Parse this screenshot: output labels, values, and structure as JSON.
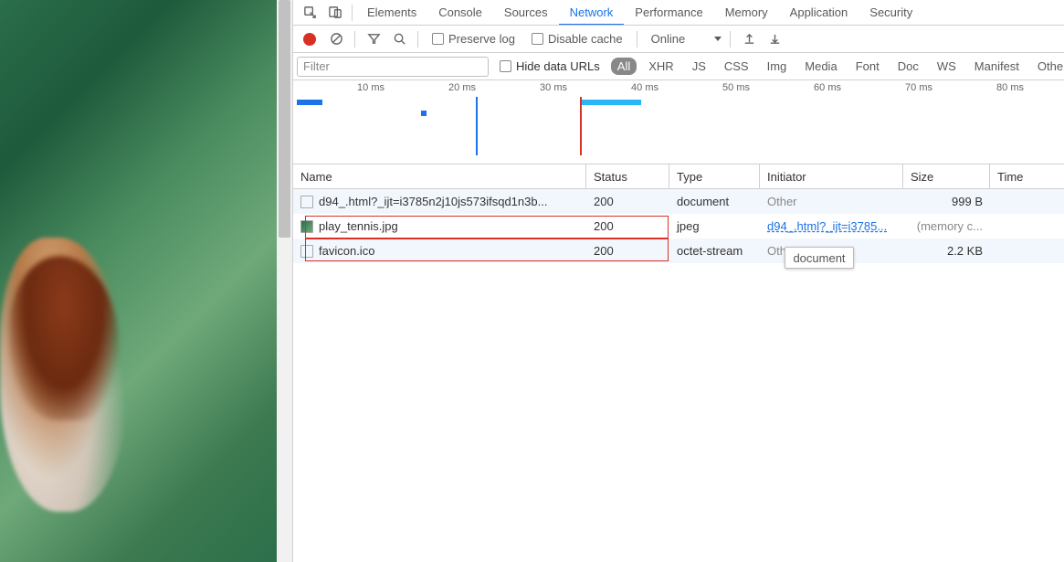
{
  "tabs": {
    "items": [
      "Elements",
      "Console",
      "Sources",
      "Network",
      "Performance",
      "Memory",
      "Application",
      "Security"
    ],
    "active": "Network"
  },
  "toolbar": {
    "preserve_log": "Preserve log",
    "disable_cache": "Disable cache",
    "throttling": "Online"
  },
  "filter": {
    "placeholder": "Filter",
    "hide_data_urls": "Hide data URLs",
    "types": [
      "All",
      "XHR",
      "JS",
      "CSS",
      "Img",
      "Media",
      "Font",
      "Doc",
      "WS",
      "Manifest",
      "Other"
    ],
    "active": "All"
  },
  "timeline": {
    "labels": [
      "10 ms",
      "20 ms",
      "30 ms",
      "40 ms",
      "50 ms",
      "60 ms",
      "70 ms",
      "80 ms"
    ]
  },
  "table": {
    "headers": {
      "name": "Name",
      "status": "Status",
      "type": "Type",
      "initiator": "Initiator",
      "size": "Size",
      "time": "Time"
    },
    "rows": [
      {
        "name": "d94_.html?_ijt=i3785n2j10js573ifsqd1n3b...",
        "status": "200",
        "type": "document",
        "initiator": "Other",
        "size": "999 B"
      },
      {
        "name": "play_tennis.jpg",
        "status": "200",
        "type": "jpeg",
        "initiator": "d94_.html?_ijt=i3785...",
        "size": "(memory c..."
      },
      {
        "name": "favicon.ico",
        "status": "200",
        "type": "octet-stream",
        "initiator": "Other",
        "size": "2.2 KB"
      }
    ]
  },
  "tooltip": "document"
}
